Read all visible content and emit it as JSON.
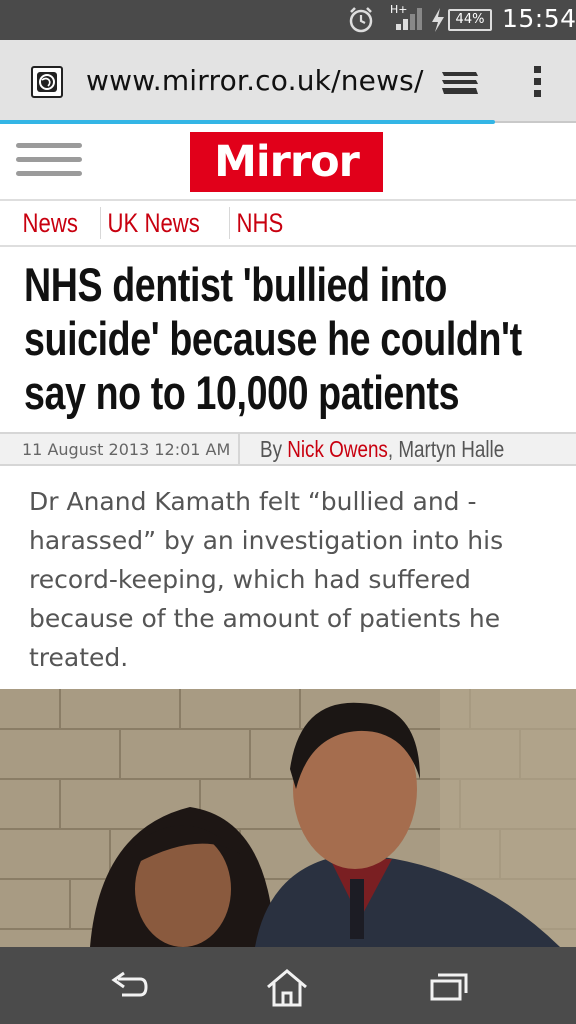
{
  "status_bar": {
    "network": "H+",
    "battery": "44%",
    "time": "15:54",
    "icons": [
      "alarm-icon",
      "signal-icon",
      "charging-icon",
      "battery-icon"
    ]
  },
  "browser": {
    "url": "www.mirror.co.uk/news/",
    "page_load_progress": 0.86,
    "icons": [
      "site-globe-icon",
      "tabs-icon",
      "overflow-menu-icon"
    ]
  },
  "site": {
    "logo_text": "Mirror",
    "brand_color": "#e1001a"
  },
  "breadcrumb": [
    "News",
    "UK News",
    "NHS"
  ],
  "article": {
    "headline": "NHS dentist 'bullied into suicide' because he couldn't say no to 10,000 patients",
    "date": "11 August 2013 12:01 AM",
    "byline_prefix": "By ",
    "author_primary": "Nick Owens",
    "author_sep": ", ",
    "author_secondary": "Martyn Halle",
    "standfirst": "Dr Anand Kamath felt “bullied and - harassed” by an investigation into his record-keeping, which had suffered because of the amount of patients he treated."
  },
  "nav_bar": {
    "icons": [
      "back-icon",
      "home-icon",
      "recent-apps-icon"
    ]
  }
}
